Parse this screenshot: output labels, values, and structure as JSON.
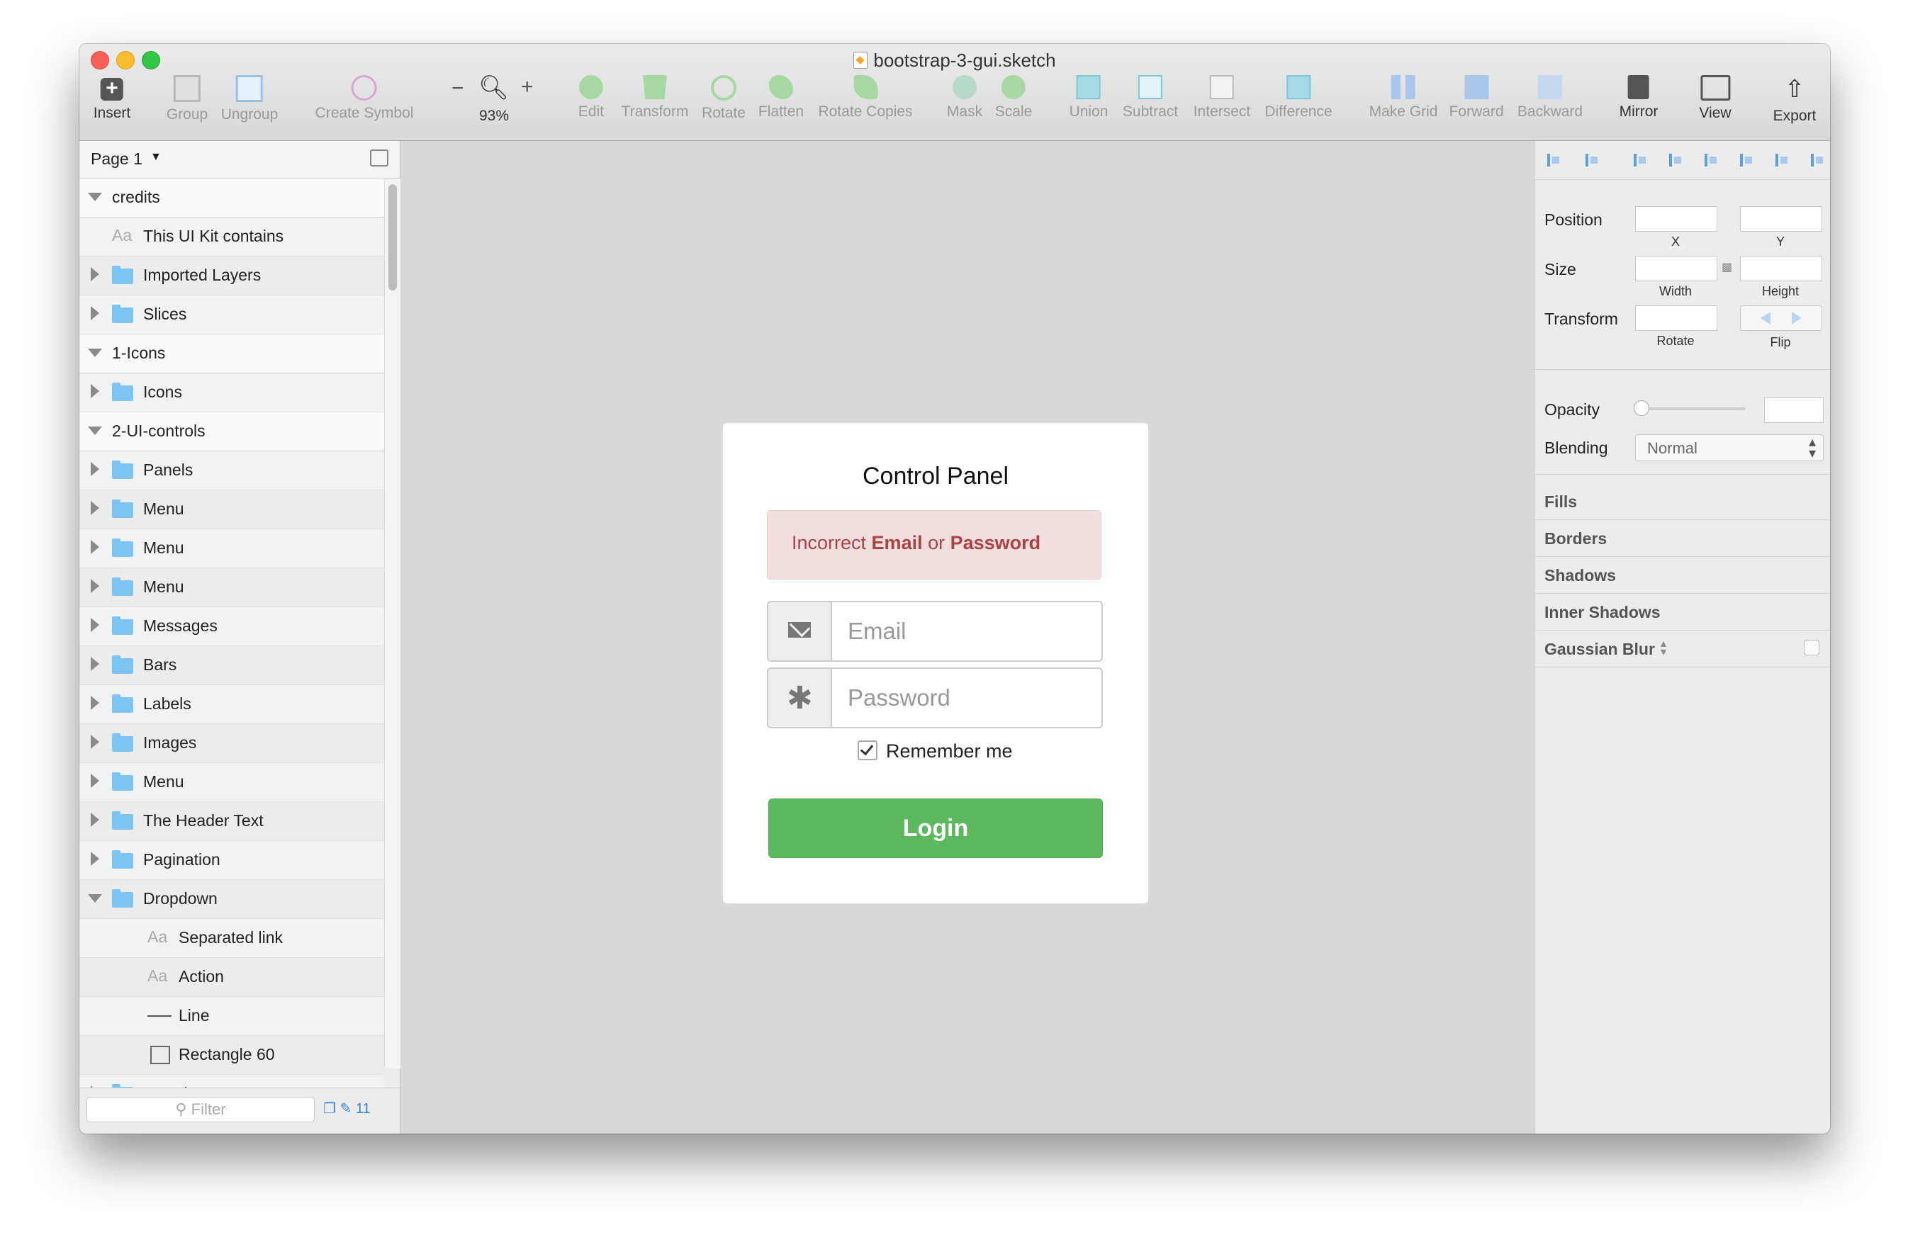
{
  "window": {
    "title": "bootstrap-3-gui.sketch"
  },
  "toolbar": {
    "insert": "Insert",
    "group": "Group",
    "ungroup": "Ungroup",
    "create_symbol": "Create Symbol",
    "zoom_value": "93%",
    "zoom_minus": "−",
    "zoom_plus": "+",
    "edit": "Edit",
    "transform": "Transform",
    "rotate": "Rotate",
    "flatten": "Flatten",
    "rotate_copies": "Rotate Copies",
    "mask": "Mask",
    "scale": "Scale",
    "union": "Union",
    "subtract": "Subtract",
    "intersect": "Intersect",
    "difference": "Difference",
    "make_grid": "Make Grid",
    "forward": "Forward",
    "backward": "Backward",
    "mirror": "Mirror",
    "view": "View",
    "export": "Export"
  },
  "sidebar": {
    "page": "Page 1",
    "layers": [
      {
        "label": "credits",
        "kind": "group",
        "expanded": true
      },
      {
        "label": "This UI Kit contains",
        "kind": "text"
      },
      {
        "label": "Imported Layers",
        "kind": "folder"
      },
      {
        "label": "Slices",
        "kind": "folder"
      },
      {
        "label": "1-Icons",
        "kind": "group",
        "expanded": true
      },
      {
        "label": "Icons",
        "kind": "folder"
      },
      {
        "label": "2-UI-controls",
        "kind": "group",
        "expanded": true
      },
      {
        "label": "Panels",
        "kind": "folder"
      },
      {
        "label": "Menu",
        "kind": "folder"
      },
      {
        "label": "Menu",
        "kind": "folder"
      },
      {
        "label": "Menu",
        "kind": "folder"
      },
      {
        "label": "Messages",
        "kind": "folder"
      },
      {
        "label": "Bars",
        "kind": "folder"
      },
      {
        "label": "Labels",
        "kind": "folder"
      },
      {
        "label": "Images",
        "kind": "folder"
      },
      {
        "label": "Menu",
        "kind": "folder"
      },
      {
        "label": "The Header Text",
        "kind": "folder"
      },
      {
        "label": "Pagination",
        "kind": "folder"
      },
      {
        "label": "Dropdown",
        "kind": "folder",
        "expanded": true
      },
      {
        "label": "Separated link",
        "kind": "text",
        "child": true
      },
      {
        "label": "Action",
        "kind": "text",
        "child": true
      },
      {
        "label": "Line",
        "kind": "line",
        "child": true
      },
      {
        "label": "Rectangle 60",
        "kind": "rect",
        "child": true
      },
      {
        "label": "Dropdown",
        "kind": "folder"
      }
    ],
    "text_icon": "Aa",
    "filter_placeholder": "Filter",
    "filter_count": "11"
  },
  "canvas": {
    "panel_title": "Control Panel",
    "alert": {
      "prefix": "Incorrect ",
      "email": "Email",
      "middle": " or ",
      "password": "Password"
    },
    "email_placeholder": "Email",
    "password_placeholder": "Password",
    "remember": "Remember me",
    "remember_checked": true,
    "login": "Login",
    "colors": {
      "alert_bg": "#f2dede",
      "alert_text": "#a94442",
      "button": "#5cb85c"
    }
  },
  "inspector": {
    "position": "Position",
    "x": "X",
    "y": "Y",
    "size": "Size",
    "width": "Width",
    "height": "Height",
    "transform": "Transform",
    "rotate": "Rotate",
    "flip": "Flip",
    "opacity": "Opacity",
    "blending": "Blending",
    "blending_value": "Normal",
    "sections": [
      "Fills",
      "Borders",
      "Shadows",
      "Inner Shadows",
      "Gaussian Blur"
    ]
  }
}
